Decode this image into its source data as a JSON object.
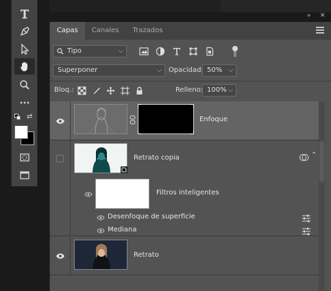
{
  "collapse_label": "«",
  "collapse_label2": "»",
  "close_glyph": "✕",
  "tabs": [
    {
      "label": "Capas"
    },
    {
      "label": "Canales"
    },
    {
      "label": "Trazados"
    }
  ],
  "filter": {
    "kind_label": "Tipo"
  },
  "blend": {
    "mode": "Superponer",
    "opacity_label": "Opacidad:",
    "opacity": "50%"
  },
  "lock": {
    "label": "Bloq.:",
    "fill_label": "Relleno:",
    "fill": "100%"
  },
  "layers": [
    {
      "name": "Enfoque",
      "visible": true
    },
    {
      "name": "Retrato copia",
      "visible": false
    },
    {
      "name": "Filtros inteligentes",
      "visible": true
    },
    {
      "name": "Desenfoque de superficie",
      "visible": true
    },
    {
      "name": "Mediana",
      "visible": true
    },
    {
      "name": "Retrato",
      "visible": true
    }
  ],
  "colors": {
    "panel": "#535353",
    "selected": "#646464",
    "dark": "#1a1a1a"
  }
}
